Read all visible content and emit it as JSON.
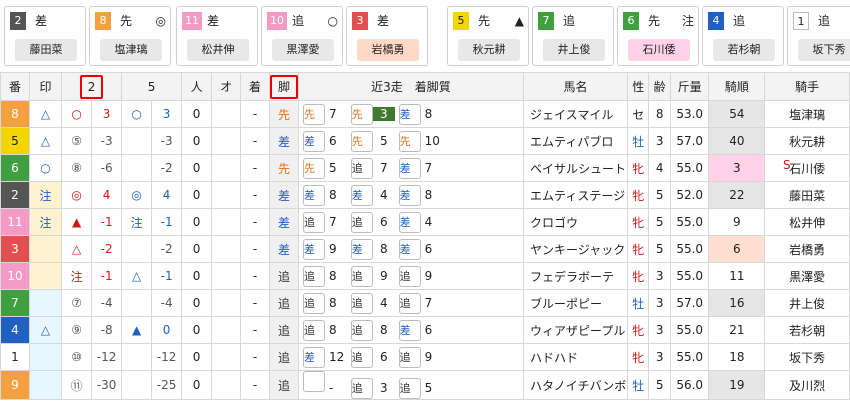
{
  "cards": [
    {
      "num": "2",
      "num_bg": "#555",
      "num_color": "#fff",
      "style": "差",
      "mark": "",
      "jockey": "藤田菜",
      "jbg": ""
    },
    {
      "num": "8",
      "num_bg": "#f4a040",
      "num_color": "#fff",
      "style": "先",
      "mark": "◎",
      "jockey": "塩津璃",
      "jbg": ""
    },
    {
      "num": "11",
      "num_bg": "#f39ac7",
      "num_color": "#fff",
      "style": "差",
      "mark": "",
      "jockey": "松井伸",
      "jbg": ""
    },
    {
      "num": "10",
      "num_bg": "#f39ac7",
      "num_color": "#fff",
      "style": "追",
      "mark": "○",
      "jockey": "黒澤愛",
      "jbg": ""
    },
    {
      "num": "3",
      "num_bg": "#e05050",
      "num_color": "#fff",
      "style": "差",
      "mark": "",
      "jockey": "岩橋勇",
      "jbg": "peach"
    },
    {
      "num": "5",
      "num_bg": "#f2d600",
      "num_color": "#222",
      "style": "先",
      "mark": "▲",
      "jockey": "秋元耕",
      "jbg": ""
    },
    {
      "num": "7",
      "num_bg": "#40a040",
      "num_color": "#fff",
      "style": "追",
      "mark": "",
      "jockey": "井上俊",
      "jbg": ""
    },
    {
      "num": "6",
      "num_bg": "#40a040",
      "num_color": "#fff",
      "style": "先",
      "mark": "注",
      "jockey": "石川倭",
      "jbg": "pink"
    },
    {
      "num": "4",
      "num_bg": "#2060c0",
      "num_color": "#fff",
      "style": "追",
      "mark": "",
      "jockey": "若杉朝",
      "jbg": ""
    },
    {
      "num": "1",
      "num_bg": "#fff",
      "num_color": "#222",
      "style": "追",
      "mark": "",
      "jockey": "坂下秀",
      "jbg": ""
    }
  ],
  "headers": {
    "ban": "番",
    "shirushi": "印",
    "m2": "2",
    "m5": "5",
    "hito": "人",
    "o": "オ",
    "chaku": "着",
    "ashi": "脚",
    "kinsou": "近3走　着脚質",
    "name": "馬名",
    "sei": "性",
    "rei": "齢",
    "kinryo": "斤量",
    "kijun": "騎順",
    "kishu": "騎手"
  },
  "rows": [
    {
      "ban": "8",
      "bg": "#f4a040",
      "fc": "#fff",
      "shirushi": "△",
      "sbg": "",
      "m2": "○",
      "m2c": "m",
      "v2": "3",
      "v2c": "m",
      "m5": "○",
      "m5c": "c",
      "v5": "3",
      "v5c": "c",
      "hito": "0",
      "o": "-",
      "ashi": "先",
      "ashic": "#e07020",
      "r1s": "先",
      "r1n": "7",
      "r1c": "#e07020",
      "r2s": "先",
      "r2n": "3",
      "r2c": "#e07020",
      "r2hl": true,
      "r3s": "差",
      "r3n": "8",
      "r3c": "#1f5fbf",
      "name": "ジェイスマイル",
      "sex": "セ",
      "sexc": "",
      "age": "8",
      "kin": "53.0",
      "kij": "54",
      "kbg": "ninki",
      "kishu": "塩津璃",
      "S": ""
    },
    {
      "ban": "5",
      "bg": "#f2d600",
      "fc": "#222",
      "shirushi": "△",
      "sbg": "",
      "m2": "⑤",
      "m2c": "l",
      "v2": "-3",
      "v2c": "l",
      "m5": "",
      "m5c": "",
      "v5": "-3",
      "v5c": "l",
      "hito": "0",
      "o": "-",
      "ashi": "差",
      "ashic": "#1f5fbf",
      "r1s": "差",
      "r1n": "6",
      "r1c": "#1f5fbf",
      "r2s": "先",
      "r2n": "5",
      "r2c": "#e07020",
      "r2hl": false,
      "r3s": "先",
      "r3n": "10",
      "r3c": "#e07020",
      "name": "エムティパブロ",
      "sex": "牡",
      "sexc": "m",
      "age": "3",
      "kin": "57.0",
      "kij": "40",
      "kbg": "ninki",
      "kishu": "秋元耕",
      "S": ""
    },
    {
      "ban": "6",
      "bg": "#40a040",
      "fc": "#fff",
      "shirushi": "○",
      "sbg": "",
      "m2": "⑧",
      "m2c": "l",
      "v2": "-6",
      "v2c": "l",
      "m5": "",
      "m5c": "",
      "v5": "-2",
      "v5c": "l",
      "hito": "0",
      "o": "-",
      "ashi": "先",
      "ashic": "#e07020",
      "r1s": "先",
      "r1n": "5",
      "r1c": "#e07020",
      "r2s": "追",
      "r2n": "7",
      "r2c": "#333",
      "r2hl": false,
      "r3s": "差",
      "r3n": "7",
      "r3c": "#1f5fbf",
      "name": "ベイサルシュート",
      "sex": "牝",
      "sexc": "f",
      "age": "4",
      "kin": "55.0",
      "kij": "3",
      "kbg": "pink",
      "kishu": "石川倭",
      "S": "S"
    },
    {
      "ban": "2",
      "bg": "#555",
      "fc": "#fff",
      "shirushi": "注",
      "sbg": "#fff2d0",
      "m2": "◎",
      "m2c": "m",
      "v2": "4",
      "v2c": "m",
      "m5": "◎",
      "m5c": "c",
      "v5": "4",
      "v5c": "c",
      "hito": "0",
      "o": "-",
      "ashi": "差",
      "ashic": "#1f5fbf",
      "r1s": "差",
      "r1n": "8",
      "r1c": "#1f5fbf",
      "r2s": "差",
      "r2n": "4",
      "r2c": "#1f5fbf",
      "r2hl": false,
      "r3s": "差",
      "r3n": "8",
      "r3c": "#1f5fbf",
      "name": "エムティステージ",
      "sex": "牝",
      "sexc": "f",
      "age": "5",
      "kin": "52.0",
      "kij": "22",
      "kbg": "ninki",
      "kishu": "藤田菜",
      "S": ""
    },
    {
      "ban": "11",
      "bg": "#f39ac7",
      "fc": "#fff",
      "shirushi": "注",
      "sbg": "#fff2d0",
      "m2": "▲",
      "m2c": "m",
      "v2": "-1",
      "v2c": "m",
      "m5": "注",
      "m5c": "c",
      "v5": "-1",
      "v5c": "c",
      "hito": "0",
      "o": "-",
      "ashi": "差",
      "ashic": "#1f5fbf",
      "r1s": "追",
      "r1n": "7",
      "r1c": "#333",
      "r2s": "追",
      "r2n": "6",
      "r2c": "#333",
      "r2hl": false,
      "r3s": "差",
      "r3n": "4",
      "r3c": "#1f5fbf",
      "name": "クロゴウ",
      "sex": "牝",
      "sexc": "f",
      "age": "5",
      "kin": "55.0",
      "kij": "9",
      "kbg": "",
      "kishu": "松井伸",
      "S": ""
    },
    {
      "ban": "3",
      "bg": "#e05050",
      "fc": "#fff",
      "shirushi": "",
      "sbg": "#fff2d0",
      "m2": "△",
      "m2c": "m",
      "v2": "-2",
      "v2c": "m",
      "m5": "",
      "m5c": "",
      "v5": "-2",
      "v5c": "l",
      "hito": "0",
      "o": "-",
      "ashi": "差",
      "ashic": "#1f5fbf",
      "r1s": "差",
      "r1n": "9",
      "r1c": "#1f5fbf",
      "r2s": "差",
      "r2n": "8",
      "r2c": "#1f5fbf",
      "r2hl": false,
      "r3s": "差",
      "r3n": "6",
      "r3c": "#1f5fbf",
      "name": "ヤンキージャック",
      "sex": "牝",
      "sexc": "f",
      "age": "5",
      "kin": "55.0",
      "kij": "6",
      "kbg": "peach",
      "kishu": "岩橋勇",
      "S": ""
    },
    {
      "ban": "10",
      "bg": "#f39ac7",
      "fc": "#fff",
      "shirushi": "",
      "sbg": "#fff2d0",
      "m2": "注",
      "m2c": "m",
      "v2": "-1",
      "v2c": "m",
      "m5": "△",
      "m5c": "c",
      "v5": "-1",
      "v5c": "c",
      "hito": "0",
      "o": "-",
      "ashi": "追",
      "ashic": "#333",
      "r1s": "追",
      "r1n": "8",
      "r1c": "#333",
      "r2s": "追",
      "r2n": "9",
      "r2c": "#333",
      "r2hl": false,
      "r3s": "追",
      "r3n": "9",
      "r3c": "#333",
      "name": "フェデラボーテ",
      "sex": "牝",
      "sexc": "f",
      "age": "3",
      "kin": "55.0",
      "kij": "11",
      "kbg": "",
      "kishu": "黒澤愛",
      "S": ""
    },
    {
      "ban": "7",
      "bg": "#40a040",
      "fc": "#fff",
      "shirushi": "",
      "sbg": "#e8f6ff",
      "m2": "⑦",
      "m2c": "l",
      "v2": "-4",
      "v2c": "l",
      "m5": "",
      "m5c": "",
      "v5": "-4",
      "v5c": "l",
      "hito": "0",
      "o": "-",
      "ashi": "追",
      "ashic": "#333",
      "r1s": "追",
      "r1n": "8",
      "r1c": "#333",
      "r2s": "追",
      "r2n": "4",
      "r2c": "#333",
      "r2hl": false,
      "r3s": "追",
      "r3n": "7",
      "r3c": "#333",
      "name": "ブルーポピー",
      "sex": "牡",
      "sexc": "m",
      "age": "3",
      "kin": "57.0",
      "kij": "16",
      "kbg": "ninki",
      "kishu": "井上俊",
      "S": ""
    },
    {
      "ban": "4",
      "bg": "#2060c0",
      "fc": "#fff",
      "shirushi": "△",
      "sbg": "#e8f6ff",
      "m2": "⑨",
      "m2c": "l",
      "v2": "-8",
      "v2c": "l",
      "m5": "▲",
      "m5c": "c",
      "v5": "0",
      "v5c": "c",
      "hito": "0",
      "o": "-",
      "ashi": "追",
      "ashic": "#333",
      "r1s": "追",
      "r1n": "8",
      "r1c": "#333",
      "r2s": "追",
      "r2n": "8",
      "r2c": "#333",
      "r2hl": false,
      "r3s": "差",
      "r3n": "6",
      "r3c": "#1f5fbf",
      "name": "ウィアザピープル",
      "sex": "牝",
      "sexc": "f",
      "age": "3",
      "kin": "55.0",
      "kij": "21",
      "kbg": "",
      "kishu": "若杉朝",
      "S": ""
    },
    {
      "ban": "1",
      "bg": "#fff",
      "fc": "#222",
      "shirushi": "",
      "sbg": "#e8f6ff",
      "m2": "⑩",
      "m2c": "l",
      "v2": "-12",
      "v2c": "l",
      "m5": "",
      "m5c": "",
      "v5": "-12",
      "v5c": "l",
      "hito": "0",
      "o": "-",
      "ashi": "追",
      "ashic": "#333",
      "r1s": "差",
      "r1n": "12",
      "r1c": "#1f5fbf",
      "r2s": "追",
      "r2n": "6",
      "r2c": "#333",
      "r2hl": false,
      "r3s": "追",
      "r3n": "9",
      "r3c": "#333",
      "name": "ハドハド",
      "sex": "牝",
      "sexc": "f",
      "age": "3",
      "kin": "55.0",
      "kij": "18",
      "kbg": "",
      "kishu": "坂下秀",
      "S": ""
    },
    {
      "ban": "9",
      "bg": "#f4a040",
      "fc": "#fff",
      "shirushi": "",
      "sbg": "#e8f6ff",
      "m2": "⑪",
      "m2c": "l",
      "v2": "-30",
      "v2c": "l",
      "m5": "",
      "m5c": "",
      "v5": "-25",
      "v5c": "l",
      "hito": "0",
      "o": "-",
      "ashi": "追",
      "ashic": "#333",
      "r1s": "",
      "r1n": "-",
      "r1c": "#333",
      "r2s": "追",
      "r2n": "3",
      "r2c": "#333",
      "r2hl": false,
      "r3s": "追",
      "r3n": "5",
      "r3c": "#333",
      "name": "ハタノイチバンボシ",
      "sex": "牡",
      "sexc": "m",
      "age": "5",
      "kin": "56.0",
      "kij": "19",
      "kbg": "ninki",
      "kishu": "及川烈",
      "S": ""
    }
  ]
}
